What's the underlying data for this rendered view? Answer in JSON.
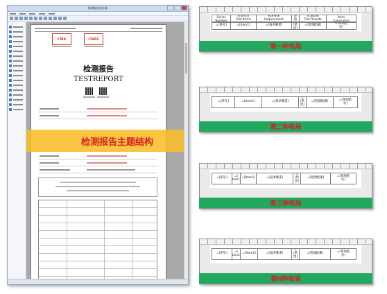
{
  "designer": {
    "window_title": "检测报告设计器",
    "banner": "检测报告主题结构",
    "page": {
      "title_cn": "检测报告",
      "title_en": "TESTREPORT",
      "logo_left": "CMA",
      "logo_right": "CNAS"
    }
  },
  "layouts": [
    {
      "label": "第一种布局",
      "header_cells": [
        "序号\nSeries\nNumber",
        "检测项目\nTest Items",
        "技术要求\nRequirement",
        "单位",
        "检测结果\nTest Results",
        "单项结论\nItem\nConclusion"
      ],
      "data_cells": [
        "=[序号]",
        "=[Item1]",
        "=[技术要求]",
        "=[单\n位]",
        "=[检测结果]",
        "=[单项结\n论]"
      ]
    },
    {
      "label": "第二种布局",
      "data_cells": [
        "=[序号]",
        "=[Item1]",
        "=[技术要求]",
        "=[单\n位]",
        "=[检测结果]",
        "=[单项结\n论]"
      ]
    },
    {
      "label": "第三种布局",
      "data_cells": [
        "=[序号]",
        "=[\nItem1]",
        "=[Item2]",
        "=[技术要求]",
        "=[单\n位]",
        "=[检测结果]",
        "=[单项结\n论]"
      ]
    },
    {
      "label": "第N种布局",
      "data_cells": [
        "=[序号]",
        "=[\nItem1]",
        "=[Item2]",
        "=[技术要求]",
        "=[单\n位]",
        "=[检测结果]",
        "=[单项结\n论]"
      ]
    }
  ]
}
